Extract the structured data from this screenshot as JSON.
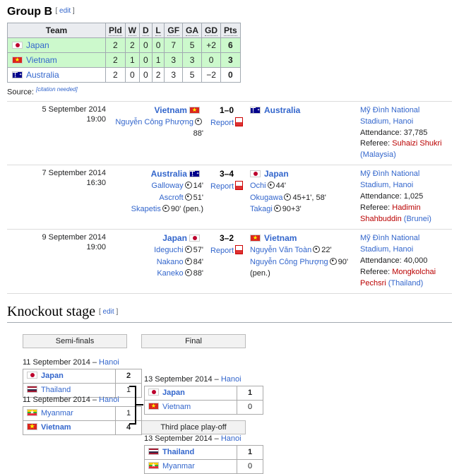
{
  "group": {
    "heading": "Group B",
    "edit": "edit",
    "columns": [
      "Team",
      "Pld",
      "W",
      "D",
      "L",
      "GF",
      "GA",
      "GD",
      "Pts"
    ],
    "rows": [
      {
        "team": "Japan",
        "flag": "japan-flag",
        "qualified": true,
        "pld": "2",
        "w": "2",
        "d": "0",
        "l": "0",
        "gf": "7",
        "ga": "5",
        "gd": "+2",
        "pts": "6"
      },
      {
        "team": "Vietnam",
        "flag": "vietnam-flag",
        "qualified": true,
        "pld": "2",
        "w": "1",
        "d": "0",
        "l": "1",
        "gf": "3",
        "ga": "3",
        "gd": "0",
        "pts": "3"
      },
      {
        "team": "Australia",
        "flag": "australia-flag",
        "qualified": false,
        "pld": "2",
        "w": "0",
        "d": "0",
        "l": "2",
        "gf": "3",
        "ga": "5",
        "gd": "−2",
        "pts": "0"
      }
    ],
    "source_label": "Source:",
    "citation": "[citation needed]"
  },
  "matches": [
    {
      "date": "5 September 2014",
      "time": "19:00",
      "home": "Vietnam",
      "home_flag": "vietnam-flag",
      "away": "Australia",
      "away_flag": "australia-flag",
      "score": "1–0",
      "report": "Report",
      "home_scorers": [
        {
          "player": "Nguyễn Công Phượng",
          "minute": "88'"
        }
      ],
      "away_scorers": [],
      "venue": "Mỹ Đình National Stadium, Hanoi",
      "attendance": "Attendance: 37,785",
      "referee_label": "Referee: ",
      "referee": "Suhaizi Shukri",
      "referee_country": "(Malaysia)"
    },
    {
      "date": "7 September 2014",
      "time": "16:30",
      "home": "Australia",
      "home_flag": "australia-flag",
      "away": "Japan",
      "away_flag": "japan-flag",
      "score": "3–4",
      "report": "Report",
      "home_scorers": [
        {
          "player": "Galloway",
          "minute": "14'"
        },
        {
          "player": "Ascroft",
          "minute": "51'"
        },
        {
          "player": "Skapetis",
          "minute": "90' (pen.)"
        }
      ],
      "away_scorers": [
        {
          "player": "Ochi",
          "minute": "44'"
        },
        {
          "player": "Okugawa",
          "minute": "45+1', 58'"
        },
        {
          "player": "Takagi",
          "minute": "90+3'"
        }
      ],
      "venue": "Mỹ Đình National Stadium, Hanoi",
      "attendance": "Attendance: 1,025",
      "referee_label": "Referee: ",
      "referee": "Hadimin Shahbuddin",
      "referee_country": "(Brunei)"
    },
    {
      "date": "9 September 2014",
      "time": "19:00",
      "home": "Japan",
      "home_flag": "japan-flag",
      "away": "Vietnam",
      "away_flag": "vietnam-flag",
      "score": "3–2",
      "report": "Report",
      "home_scorers": [
        {
          "player": "Ideguchi",
          "minute": "57'"
        },
        {
          "player": "Nakano",
          "minute": "84'"
        },
        {
          "player": "Kaneko",
          "minute": "88'"
        }
      ],
      "away_scorers": [
        {
          "player": "Nguyễn Văn Toàn",
          "minute": "22'"
        },
        {
          "player": "Nguyễn Công Phượng",
          "minute": "90' (pen.)"
        }
      ],
      "venue": "Mỹ Đình National Stadium, Hanoi",
      "attendance": "Attendance: 40,000",
      "referee_label": "Referee: ",
      "referee": "Mongkolchai Pechsri",
      "referee_country": "(Thailand)"
    }
  ],
  "knockout": {
    "heading": "Knockout stage",
    "edit": "edit",
    "round_headers": [
      "Semi-finals",
      "Final",
      "Third place play-off"
    ],
    "semifinals": [
      {
        "date": "11 September 2014 – ",
        "city": "Hanoi",
        "teams": [
          {
            "name": "Japan",
            "flag": "japan-flag",
            "score": "2",
            "winner": true
          },
          {
            "name": "Thailand",
            "flag": "thailand-flag",
            "score": "1",
            "winner": false
          }
        ]
      },
      {
        "date": "11 September 2014 – ",
        "city": "Hanoi",
        "teams": [
          {
            "name": "Myanmar",
            "flag": "myanmar-flag",
            "score": "1",
            "winner": false
          },
          {
            "name": "Vietnam",
            "flag": "vietnam-flag",
            "score": "4",
            "winner": true
          }
        ]
      }
    ],
    "final": {
      "date": "13 September 2014 – ",
      "city": "Hanoi",
      "teams": [
        {
          "name": "Japan",
          "flag": "japan-flag",
          "score": "1",
          "winner": true
        },
        {
          "name": "Vietnam",
          "flag": "vietnam-flag",
          "score": "0",
          "winner": false
        }
      ]
    },
    "third_place": {
      "date": "13 September 2014 – ",
      "city": "Hanoi",
      "teams": [
        {
          "name": "Thailand",
          "flag": "thailand-flag",
          "score": "1",
          "winner": true
        },
        {
          "name": "Myanmar",
          "flag": "myanmar-flag",
          "score": "0",
          "winner": false
        }
      ]
    }
  },
  "colors": {
    "link": "#3366cc",
    "qualified_row": "#ccf9cc",
    "header_bg": "#eaecf0",
    "border": "#a2a9b1",
    "red_link": "#ba0000"
  }
}
